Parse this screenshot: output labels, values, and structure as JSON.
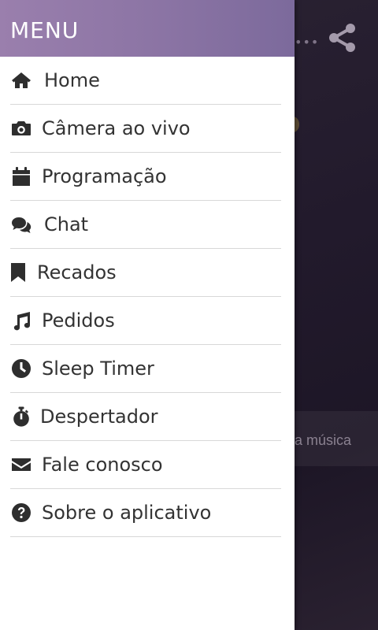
{
  "drawer": {
    "title": "MENU",
    "items": [
      {
        "label": "Home",
        "icon": "home-icon"
      },
      {
        "label": "Câmera ao vivo",
        "icon": "camera-icon"
      },
      {
        "label": "Programação",
        "icon": "calendar-icon"
      },
      {
        "label": "Chat",
        "icon": "chat-icon"
      },
      {
        "label": "Recados",
        "icon": "bookmark-icon"
      },
      {
        "label": "Pedidos",
        "icon": "music-icon"
      },
      {
        "label": "Sleep Timer",
        "icon": "clock-icon"
      },
      {
        "label": "Despertador",
        "icon": "stopwatch-icon"
      },
      {
        "label": "Fale conosco",
        "icon": "envelope-icon"
      },
      {
        "label": "Sobre o aplicativo",
        "icon": "question-icon"
      }
    ]
  },
  "background": {
    "strip_text": "a música",
    "share_icon": "share-icon",
    "more_icon": "more-dots-icon"
  },
  "colors": {
    "header_gradient_start": "#9a7fad",
    "header_gradient_end": "#7c6a9c",
    "icon_color": "#2e2e2e",
    "text_color": "#333333"
  }
}
